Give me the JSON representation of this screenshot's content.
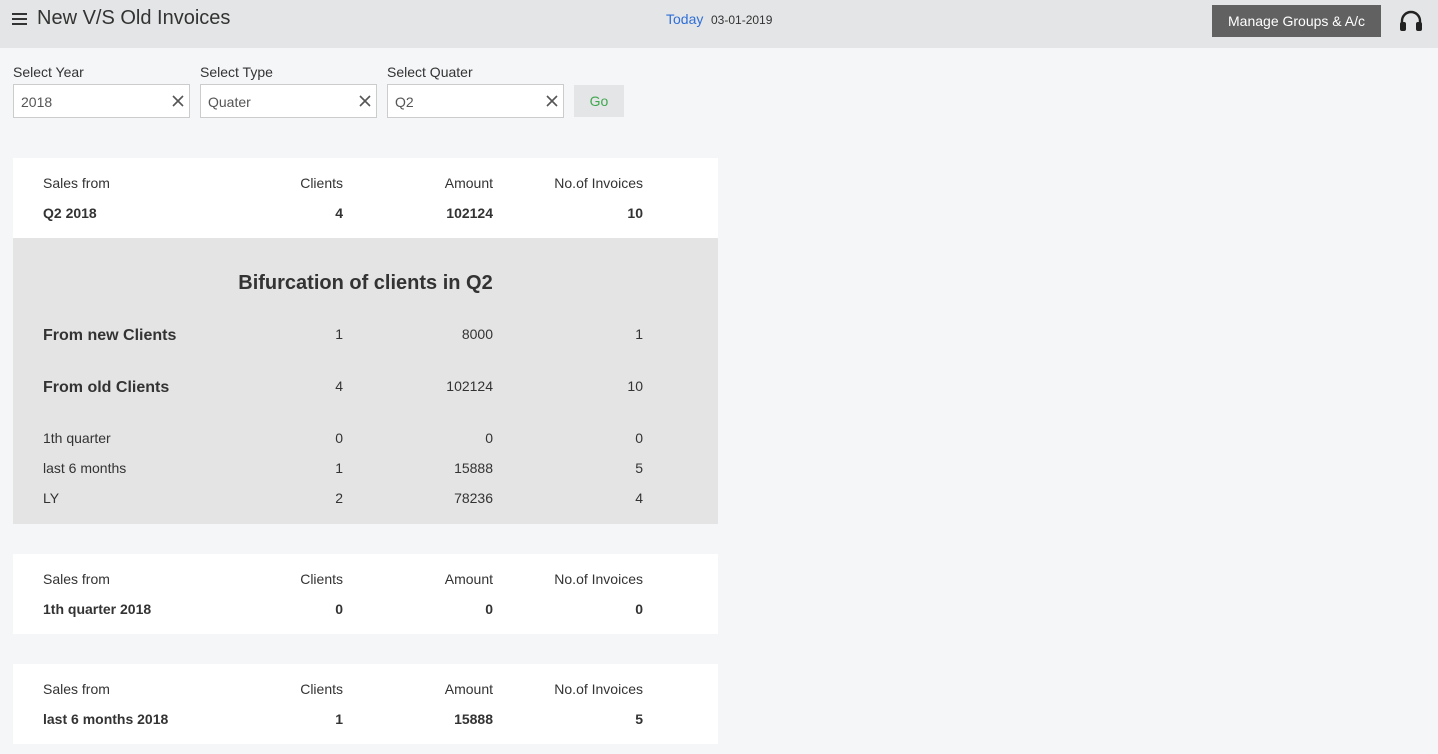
{
  "header": {
    "title": "New V/S Old Invoices",
    "today_label": "Today",
    "today_date": "03-01-2019",
    "manage_button": "Manage Groups & A/c"
  },
  "filters": {
    "year_label": "Select Year",
    "year_value": "2018",
    "type_label": "Select Type",
    "type_value": "Quater",
    "quarter_label": "Select Quater",
    "quarter_value": "Q2",
    "go_button": "Go"
  },
  "columns": {
    "sales_from": "Sales from",
    "clients": "Clients",
    "amount": "Amount",
    "invoices": "No.of Invoices"
  },
  "summary_q2": {
    "period": "Q2 2018",
    "clients": "4",
    "amount": "102124",
    "invoices": "10"
  },
  "bifurcation": {
    "title": "Bifurcation of clients in Q2",
    "rows": [
      {
        "label": "From new Clients",
        "clients": "1",
        "amount": "8000",
        "invoices": "1"
      },
      {
        "label": "From old Clients",
        "clients": "4",
        "amount": "102124",
        "invoices": "10"
      },
      {
        "label": "1th quarter",
        "clients": "0",
        "amount": "0",
        "invoices": "0"
      },
      {
        "label": "last 6 months",
        "clients": "1",
        "amount": "15888",
        "invoices": "5"
      },
      {
        "label": "LY",
        "clients": "2",
        "amount": "78236",
        "invoices": "4"
      }
    ]
  },
  "summary_q1": {
    "period": "1th quarter 2018",
    "clients": "0",
    "amount": "0",
    "invoices": "0"
  },
  "summary_6m": {
    "period": "last 6 months 2018",
    "clients": "1",
    "amount": "15888",
    "invoices": "5"
  },
  "icons": {
    "menu": "hamburger-menu-icon",
    "support": "headset-icon",
    "clear": "close-icon"
  }
}
